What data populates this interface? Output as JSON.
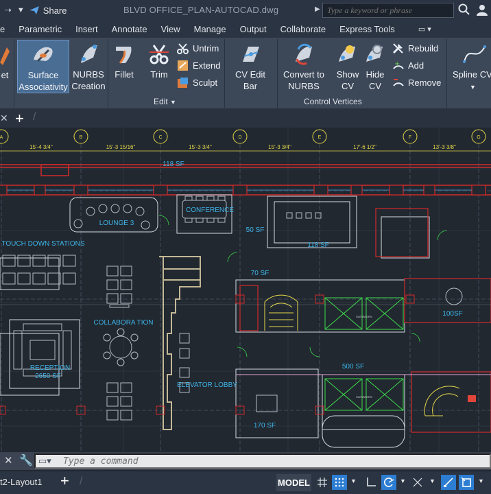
{
  "titlebar": {
    "share_label": "Share",
    "document_title": "BLVD OFFICE_PLAN-AUTOCAD.dwg",
    "search_placeholder": "Type a keyword or phrase"
  },
  "menu": [
    "e",
    "Parametric",
    "Insert",
    "Annotate",
    "View",
    "Manage",
    "Output",
    "Collaborate",
    "Express Tools"
  ],
  "ribbon": {
    "partial_left": "et",
    "surface_assoc": [
      "Surface",
      "Associativity"
    ],
    "nurbs_creation": [
      "NURBS",
      "Creation"
    ],
    "fillet": "Fillet",
    "trim": "Trim",
    "untrim": "Untrim",
    "extend": "Extend",
    "sculpt": "Sculpt",
    "edit_panel": "Edit",
    "cv_edit_bar": "CV Edit Bar",
    "convert_nurbs": [
      "Convert to",
      "NURBS"
    ],
    "show_cv": [
      "Show",
      "CV"
    ],
    "hide_cv": [
      "Hide",
      "CV"
    ],
    "rebuild": "Rebuild",
    "add": "Add",
    "remove": "Remove",
    "control_vertices_panel": "Control Vertices",
    "spline_cv": "Spline CV"
  },
  "drawing": {
    "grid_labels": [
      "A",
      "B",
      "C",
      "D",
      "E",
      "F",
      "G"
    ],
    "dimensions": [
      "15'-4 3/4\"",
      "15'-3 15/16\"",
      "15'-3 3/4\"",
      "15'-3 3/4\"",
      "17'-6 1/2\"",
      "13'-3 3/8\""
    ],
    "rooms": {
      "r118_top": "118 SF",
      "conference": "CONFERENCE",
      "lounge": "LOUNGE 3",
      "r50": "50 SF",
      "r118_mid": "118 SF",
      "touchdown": "TOUCH DOWN STATIONS",
      "r70": "70 SF",
      "collaboration": "COLLABORA TION",
      "r100": "100SF",
      "reception": "RECEPTION",
      "r2650": "2650 SF",
      "r500": "500 SF",
      "elevator_lobby": "ELEVATOR LOBBY",
      "r170": "170 SF",
      "elevators": "ELEVATORS"
    }
  },
  "command": {
    "placeholder": "Type a command"
  },
  "status": {
    "layout_tab": "t2-Layout1",
    "model": "MODEL"
  }
}
